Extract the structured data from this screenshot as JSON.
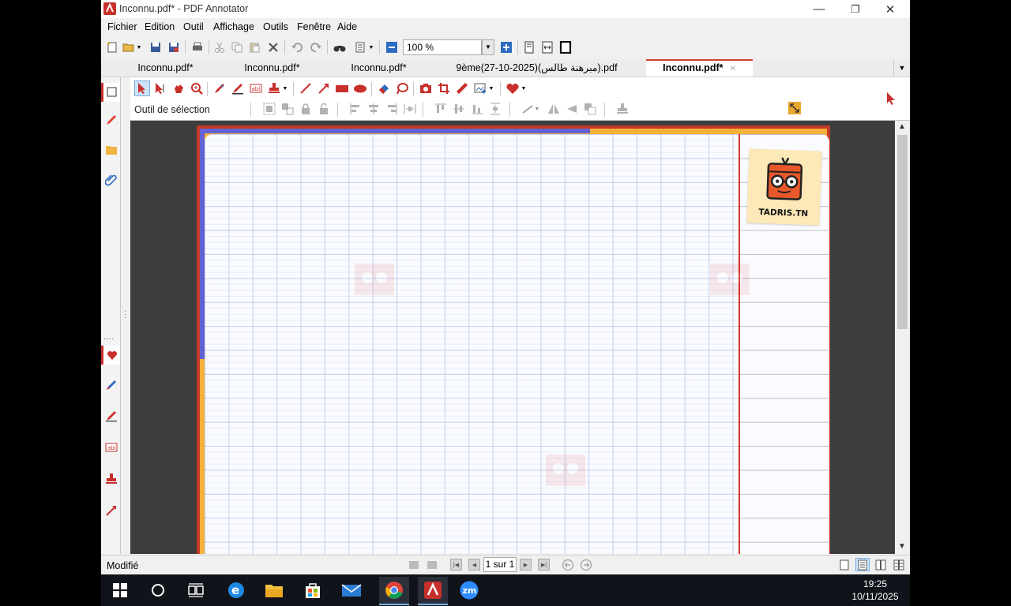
{
  "window": {
    "title": "Inconnu.pdf* - PDF Annotator",
    "minimize_glyph": "—",
    "restore_glyph": "❐",
    "close_glyph": "✕"
  },
  "menu": [
    "Fichier",
    "Edition",
    "Outil",
    "Affichage",
    "Outils",
    "Fenêtre",
    "Aide"
  ],
  "toolbar": {
    "zoom_value": "100 %"
  },
  "tabs": [
    {
      "label": "Inconnu.pdf*"
    },
    {
      "label": "Inconnu.pdf*"
    },
    {
      "label": "Inconnu.pdf*"
    },
    {
      "label": "9ème(27-10-2025)(مبرهنة طالس).pdf"
    },
    {
      "label": "Inconnu.pdf*",
      "active": true
    }
  ],
  "tab_close_glyph": "✕",
  "tool_panel": {
    "current_tool": "Outil de sélection"
  },
  "document": {
    "logo_text": "TADRIS.TN"
  },
  "status": {
    "text": "Modifié",
    "page_indicator": "1 sur 1"
  },
  "taskbar": {
    "time": "19:25",
    "date": "10/11/2025",
    "zoom_app_label": "zm"
  },
  "colors": {
    "accent": "#c8302c",
    "selection_blue": "#cde3f7",
    "page_border": "#c43a2a",
    "taskbar": "#10131a"
  }
}
